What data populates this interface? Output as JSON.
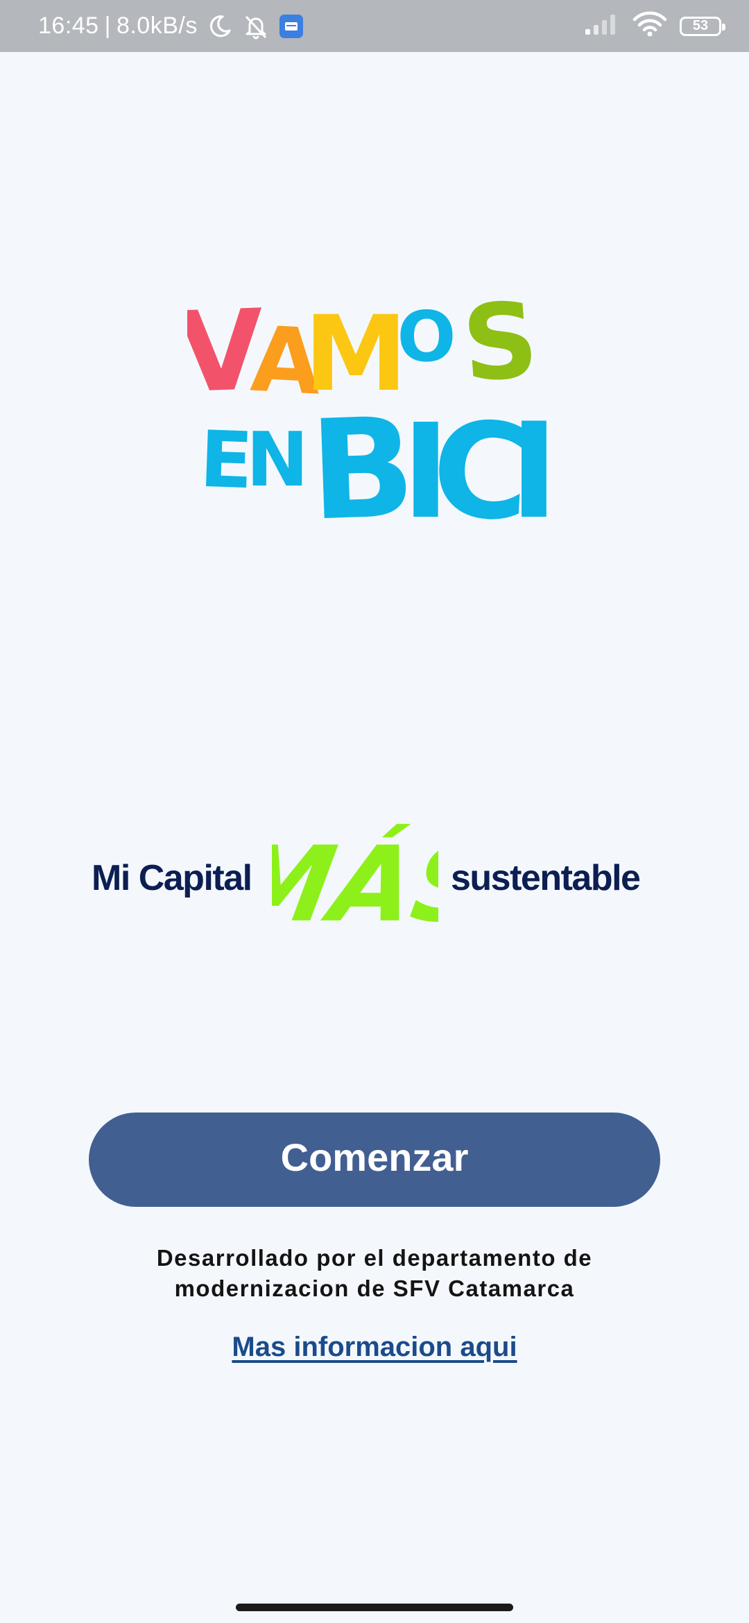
{
  "status_bar": {
    "time": "16:45",
    "network_speed": "8.0kB/s",
    "separator": "|",
    "battery_level": "53",
    "icons": [
      "moon-icon",
      "bell-off-icon",
      "notification-app-icon",
      "signal-icon",
      "wifi-icon",
      "battery-icon"
    ]
  },
  "logo": {
    "line1": [
      "V",
      "A",
      "M",
      "O",
      "S"
    ],
    "line2_small": [
      "E",
      "N"
    ],
    "line2_big": [
      "B",
      "I",
      "C",
      "I"
    ],
    "colors": {
      "V": "#f3526b",
      "A": "#fb9d1d",
      "M": "#fbc713",
      "O": "#0eb5e6",
      "S": "#8ebf15",
      "EN": "#0eb5e6",
      "BICI": "#0eb5e6"
    }
  },
  "tagline": {
    "left": "Mi Capital",
    "highlight": "MÁS",
    "right": "sustentable",
    "text_color": "#0c1e52",
    "highlight_color": "#8ef01a"
  },
  "start_button": {
    "label": "Comenzar",
    "color": "#425f91"
  },
  "footer": {
    "dev_line1": "Desarrollado por el departamento de",
    "dev_line2": "modernizacion de SFV Catamarca",
    "more_info": "Mas informacion aqui"
  }
}
